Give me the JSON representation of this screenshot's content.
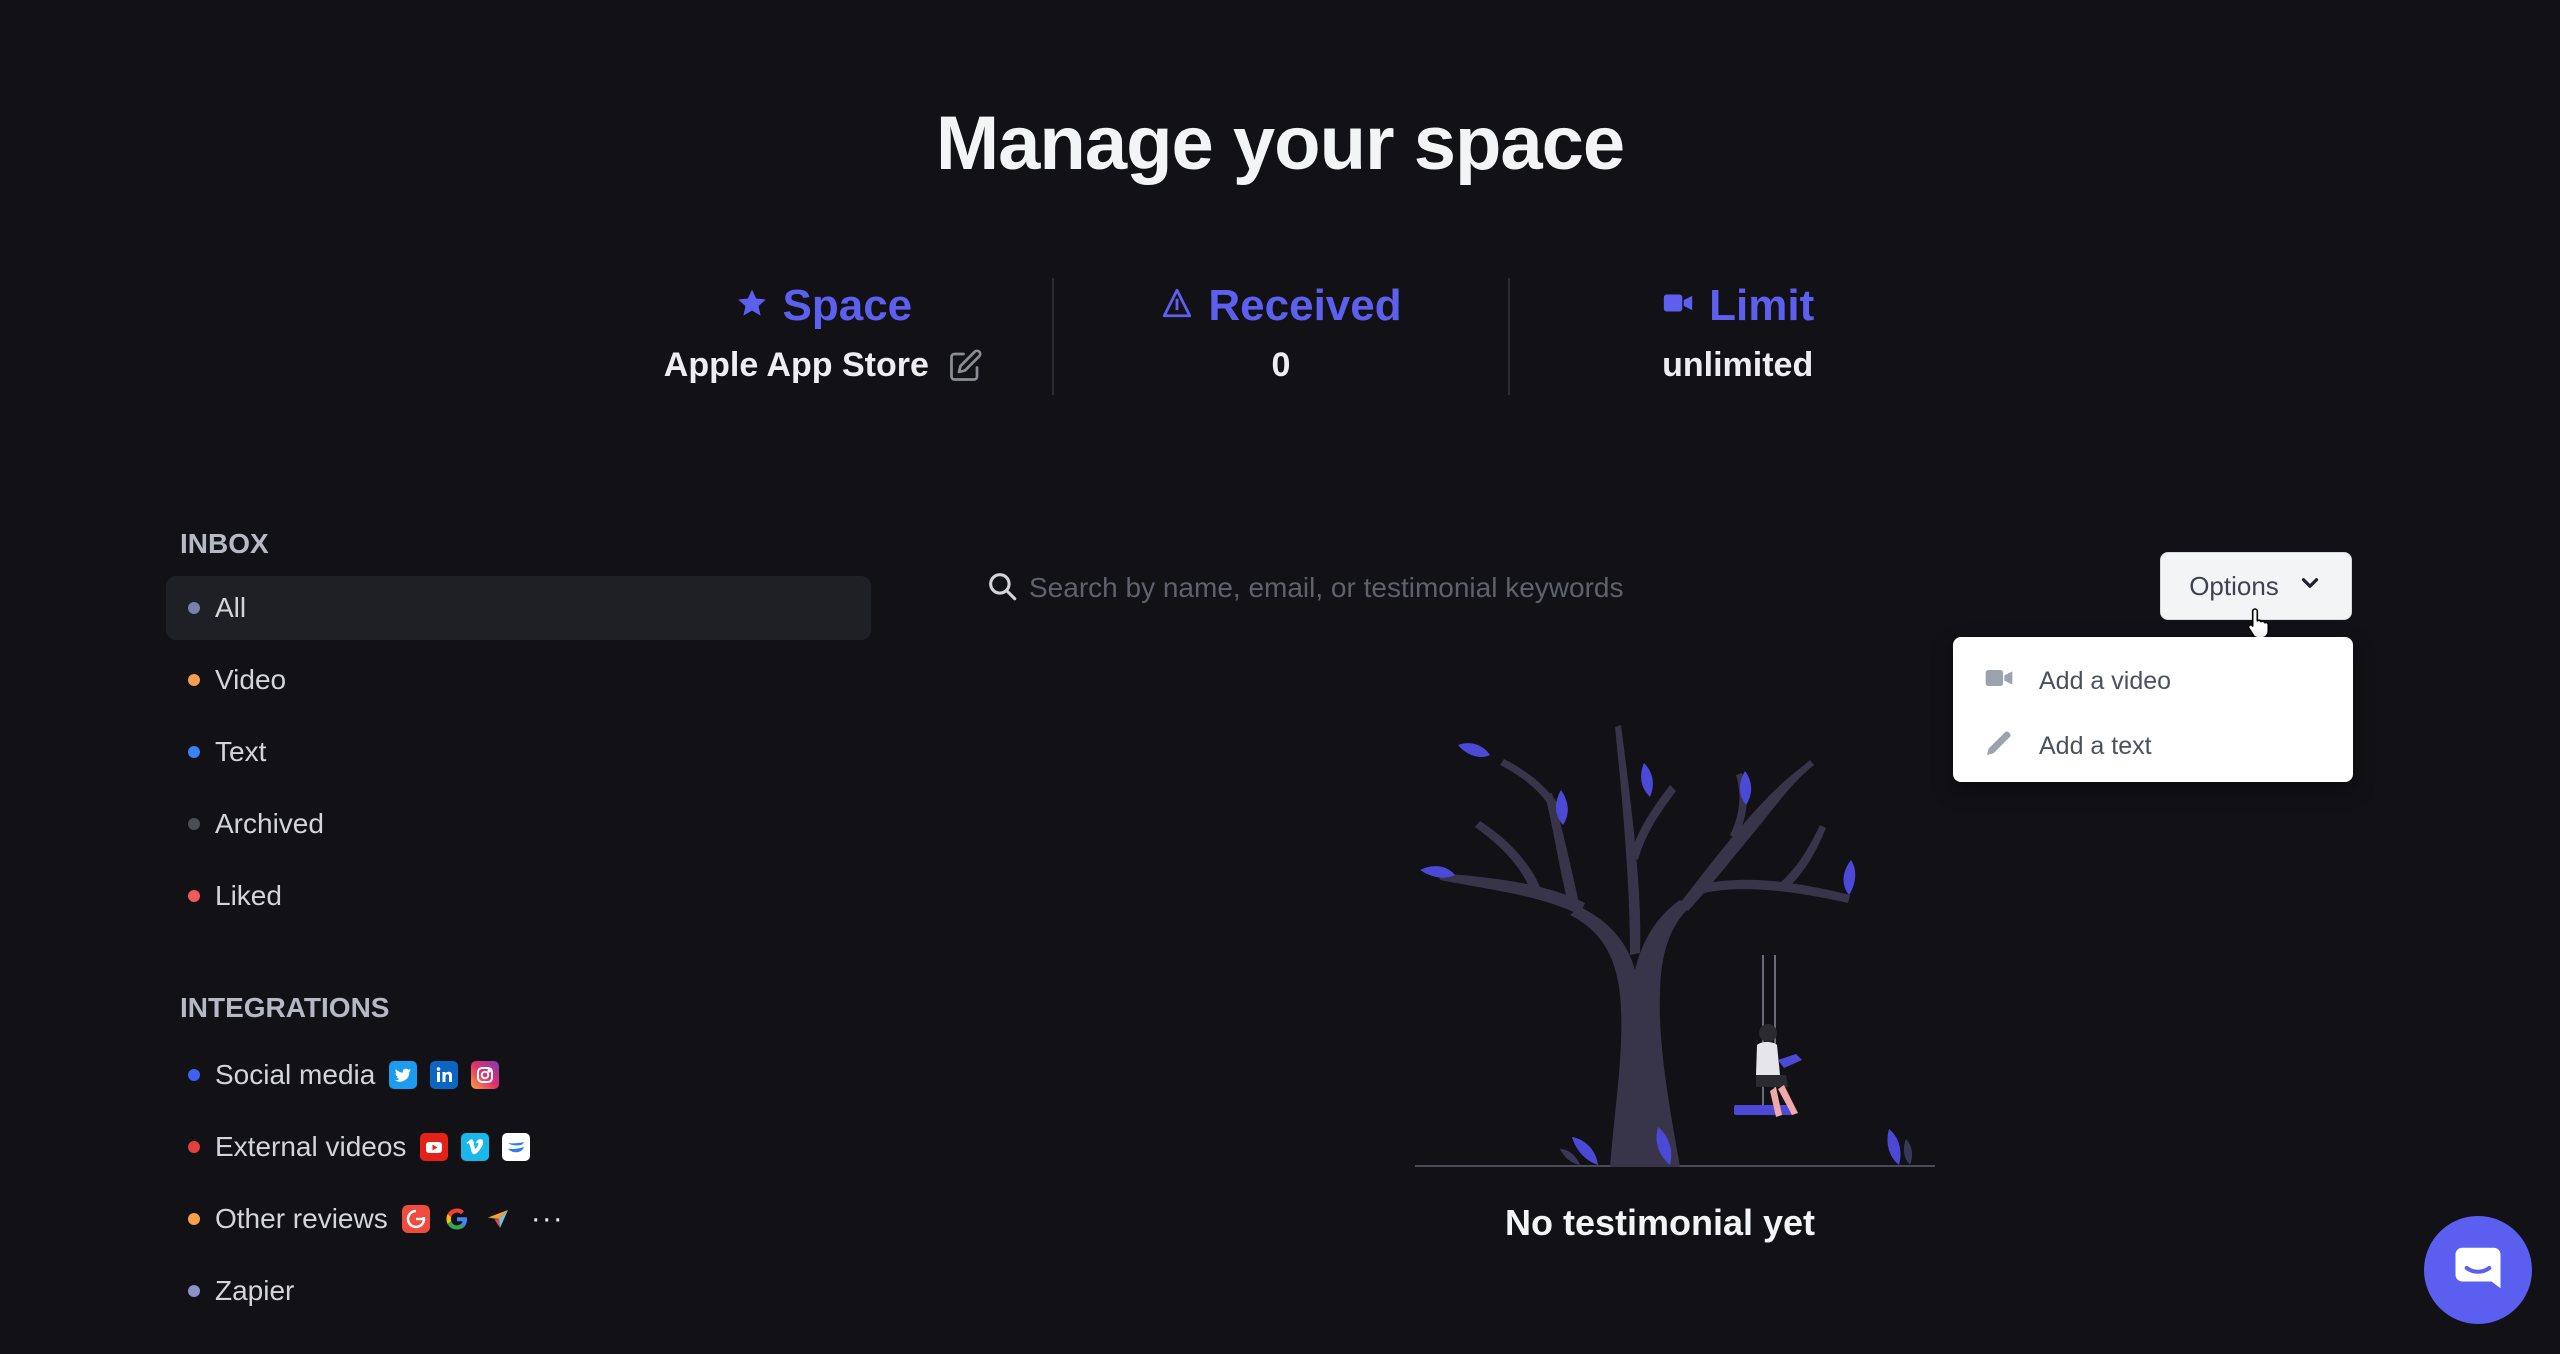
{
  "page": {
    "title": "Manage your space"
  },
  "stats": {
    "space": {
      "label": "Space",
      "value": "Apple App Store",
      "icon": "star-icon"
    },
    "received": {
      "label": "Received",
      "value": "0",
      "icon": "triangle-icon"
    },
    "limit": {
      "label": "Limit",
      "value": "unlimited",
      "icon": "video-camera-icon"
    }
  },
  "sidebar": {
    "inbox_title": "INBOX",
    "inbox": [
      {
        "label": "All",
        "dot": "#7b7fb0"
      },
      {
        "label": "Video",
        "dot": "#f59e52"
      },
      {
        "label": "Text",
        "dot": "#3b82f6"
      },
      {
        "label": "Archived",
        "dot": "#4b4d55"
      },
      {
        "label": "Liked",
        "dot": "#ef5a5a"
      }
    ],
    "integrations_title": "INTEGRATIONS",
    "integrations": [
      {
        "label": "Social media",
        "dot": "#3d63f0",
        "icons": [
          "twitter-icon",
          "linkedin-icon",
          "instagram-icon"
        ]
      },
      {
        "label": "External videos",
        "dot": "#e53e3e",
        "icons": [
          "youtube-icon",
          "vimeo-icon",
          "wistia-icon"
        ]
      },
      {
        "label": "Other reviews",
        "dot": "#f6a04a",
        "icons": [
          "g2-icon",
          "google-icon",
          "capterra-icon",
          "more-icon"
        ]
      },
      {
        "label": "Zapier",
        "dot": "#8d91c7"
      }
    ]
  },
  "search": {
    "placeholder": "Search by name, email, or testimonial keywords"
  },
  "options": {
    "label": "Options",
    "items": [
      {
        "label": "Add a video",
        "icon": "video-camera-icon"
      },
      {
        "label": "Add a text",
        "icon": "pencil-icon"
      }
    ]
  },
  "empty_state": {
    "message": "No testimonial yet"
  },
  "colors": {
    "accent": "#5d5fef",
    "background": "#111116"
  }
}
